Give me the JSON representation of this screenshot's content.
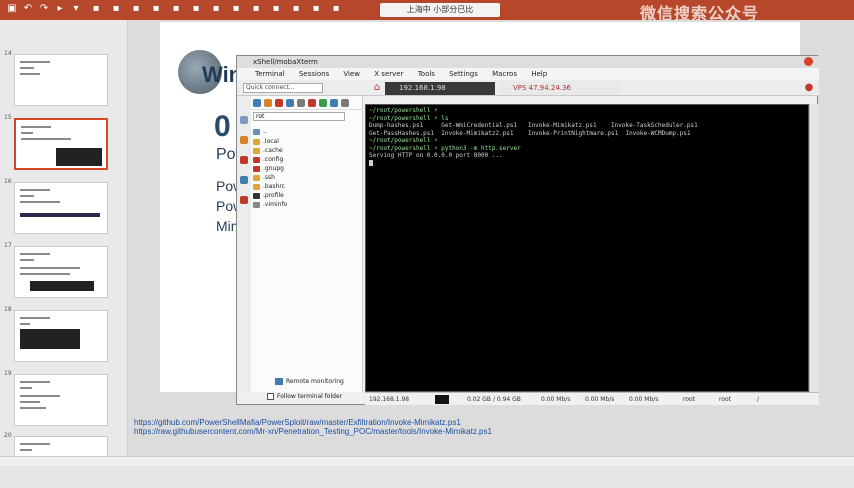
{
  "window": {
    "title": "上海中 小部分已比",
    "watermark": "微信搜索公众号"
  },
  "slides": {
    "numbers": [
      "14",
      "15",
      "16",
      "17",
      "18",
      "19",
      "20"
    ]
  },
  "slide": {
    "logo_text": "Win",
    "big_number": "0",
    "line1": "Pow",
    "line2": "Powe",
    "line3": "Pow",
    "line4": "Mimi"
  },
  "app": {
    "title": "xShell/mobaXterm",
    "menu": [
      "Terminal",
      "Sessions",
      "View",
      "X server",
      "Tools",
      "Settings",
      "Macros",
      "Help"
    ],
    "quick_connect": "Quick connect...",
    "tabs": [
      "192.168.1.98",
      "VPS 47.94.24.36"
    ],
    "filter": "rot",
    "tree": [
      {
        "name": "..",
        "value": ""
      },
      {
        "name": ".local",
        "value": ""
      },
      {
        "name": ".cache",
        "value": ""
      },
      {
        "name": ".config",
        "value": ""
      },
      {
        "name": ".gnupg",
        "value": ""
      },
      {
        "name": ".ssh",
        "value": ""
      },
      {
        "name": ".bashrc",
        "value": ""
      },
      {
        "name": ".profile",
        "value": ""
      },
      {
        "name": ".viminfo",
        "value": ""
      }
    ],
    "remote_monitoring": "Remote monitoring",
    "follow_terminal": "Follow terminal folder",
    "terminal_lines": [
      "~/root/powershell ⚡",
      "~/root/powershell ⚡ ls",
      "Dump-hashes.ps1     Get-WmiCredential.ps1   Invoke-Mimikatz.ps1    Invoke-TaskScheduler.ps1",
      "Get-PassHashes.ps1  Invoke-Mimikatz2.ps1    Invoke-PrintNightmare.ps1  Invoke-WCMDump.ps1",
      "~/root/powershell ⚡",
      "~/root/powershell ⚡ python3 -m http.server",
      "Serving HTTP on 0.0.0.0 port 8000 ..."
    ],
    "status": [
      "192.168.1.98",
      "0.02 GB / 0.94 GB",
      "0.00 Mb/s",
      "0.00 Mb/s",
      "0.00 Mb/s",
      "root",
      "root",
      "/"
    ]
  },
  "links": [
    "https://github.com/PowerShellMafia/PowerSploit/raw/master/Exfiltration/Invoke-Mimikatz.ps1",
    "https://raw.githubusercontent.com/Mr-xn/Penetration_Testing_POC/master/tools/Invoke-Mimikatz.ps1"
  ]
}
